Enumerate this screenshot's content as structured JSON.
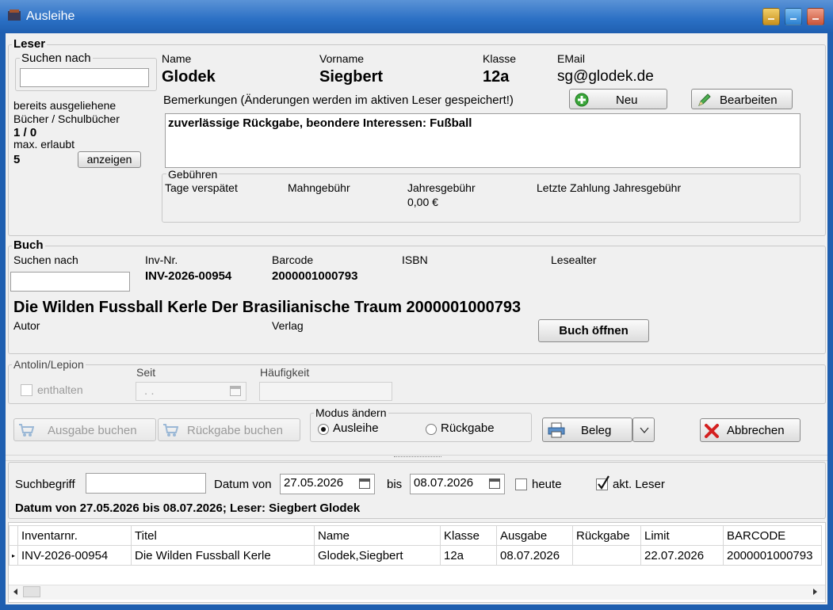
{
  "window": {
    "title": "Ausleihe"
  },
  "leser": {
    "group_label": "Leser",
    "search": {
      "label": "Suchen nach",
      "value": ""
    },
    "loaned_label_line1": "bereits ausgeliehene",
    "loaned_label_line2": "Bücher / Schulbücher",
    "loaned_value": "1 / 0",
    "max_label": "max. erlaubt",
    "max_value": "5",
    "show_button": "anzeigen",
    "name_label": "Name",
    "name_value": "Glodek",
    "vorname_label": "Vorname",
    "vorname_value": "Siegbert",
    "klasse_label": "Klasse",
    "klasse_value": "12a",
    "email_label": "EMail",
    "email_value": "sg@glodek.de",
    "remarks_label": "Bemerkungen (Änderungen werden im aktiven Leser gespeichert!)",
    "remarks_value": "zuverlässige Rückgabe, beondere Interessen: Fußball",
    "new_button": "Neu",
    "edit_button": "Bearbeiten",
    "fees": {
      "group_label": "Gebühren",
      "late_label": "Tage verspätet",
      "reminder_label": "Mahngebühr",
      "annual_label": "Jahresgebühr",
      "annual_value": "0,00 €",
      "last_payment_label": "Letzte Zahlung Jahresgebühr"
    }
  },
  "buch": {
    "group_label": "Buch",
    "search": {
      "label": "Suchen nach",
      "value": ""
    },
    "inv_label": "Inv-Nr.",
    "inv_value": "INV-2026-00954",
    "barcode_label": "Barcode",
    "barcode_value": "2000001000793",
    "isbn_label": "ISBN",
    "age_label": "Lesealter",
    "title_value": "Die Wilden Fussball Kerle Der Brasilianische Traum 2000001000793",
    "author_label": "Autor",
    "publisher_label": "Verlag",
    "open_button": "Buch öffnen"
  },
  "antolin": {
    "group_label": "Antolin/Lepion",
    "contained_label": "enthalten",
    "since_label": "Seit",
    "since_value": ".  .",
    "frequency_label": "Häufigkeit"
  },
  "actions": {
    "checkout_button": "Ausgabe buchen",
    "return_button": "Rückgabe buchen",
    "mode": {
      "group_label": "Modus ändern",
      "option_loan": "Ausleihe",
      "option_return": "Rückgabe",
      "selected": "Ausleihe"
    },
    "receipt_button": "Beleg",
    "cancel_button": "Abbrechen"
  },
  "filter": {
    "search_label": "Suchbegriff",
    "search_value": "",
    "date_from_label": "Datum von",
    "date_from_value": "27.05.2026",
    "to_label": "bis",
    "date_to_value": "08.07.2026",
    "today_label": "heute",
    "today_checked": false,
    "current_reader_label": "akt. Leser",
    "current_reader_checked": true,
    "summary": "Datum von 27.05.2026 bis 08.07.2026; Leser: Siegbert Glodek"
  },
  "table": {
    "columns": [
      "Inventarnr.",
      "Titel",
      "Name",
      "Klasse",
      "Ausgabe",
      "Rückgabe",
      "Limit",
      "BARCODE"
    ],
    "rows": [
      [
        "INV-2026-00954",
        "Die Wilden Fussball Kerle",
        "Glodek,Siegbert",
        "12a",
        "08.07.2026",
        "",
        "22.07.2026",
        "2000001000793"
      ]
    ]
  }
}
